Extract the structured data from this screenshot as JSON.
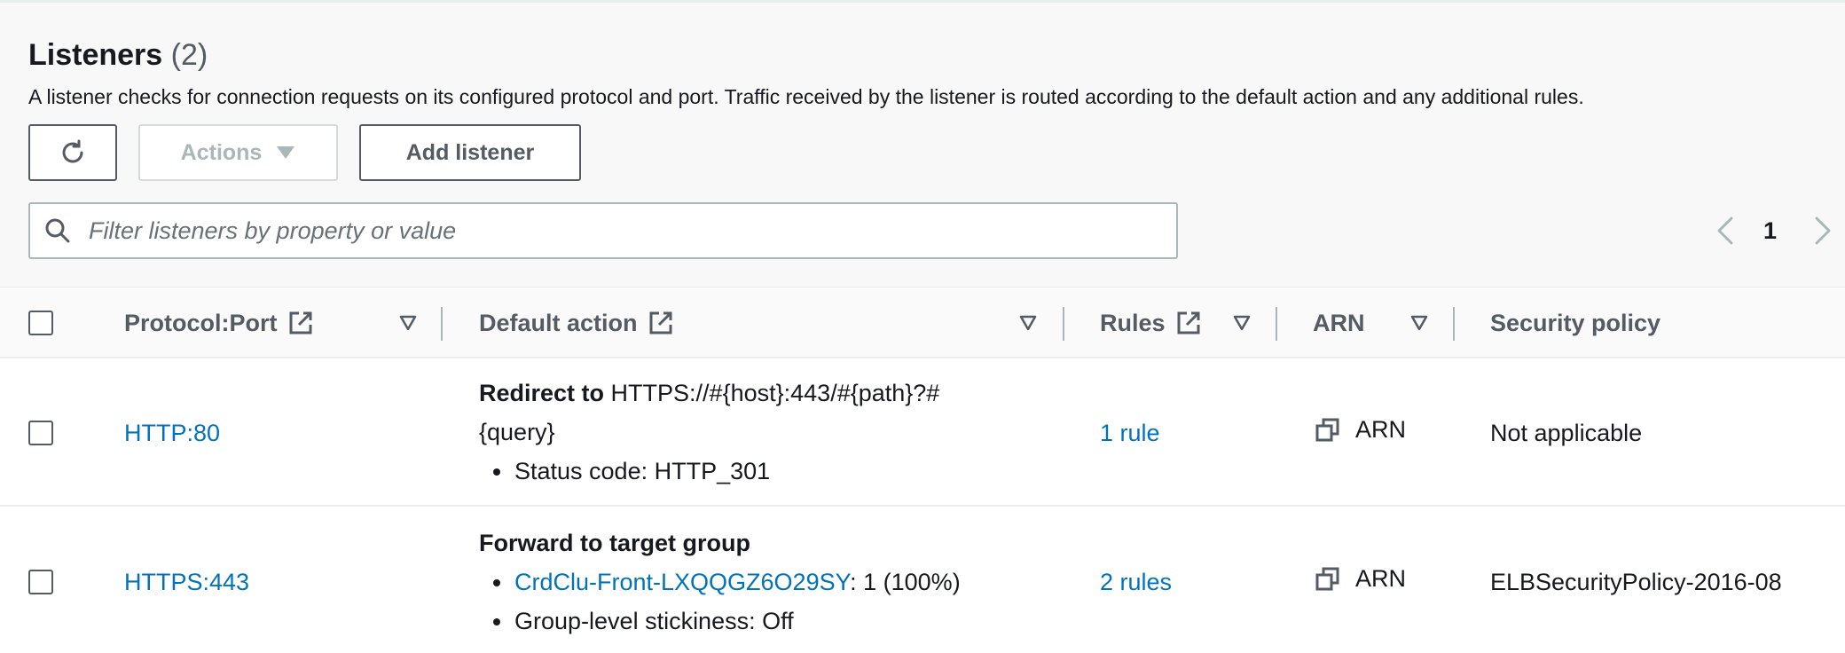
{
  "header": {
    "title": "Listeners",
    "count": "(2)",
    "description": "A listener checks for connection requests on its configured protocol and port. Traffic received by the listener is routed according to the default action and any additional rules."
  },
  "toolbar": {
    "refresh_icon": "refresh-icon",
    "actions_label": "Actions",
    "add_listener_label": "Add listener"
  },
  "filter": {
    "placeholder": "Filter listeners by property or value"
  },
  "pagination": {
    "current_page": "1"
  },
  "table": {
    "columns": {
      "protocol_port": "Protocol:Port",
      "default_action": "Default action",
      "rules": "Rules",
      "arn": "ARN",
      "security_policy": "Security policy"
    },
    "rows": [
      {
        "protocol_port": "HTTP:80",
        "action_title": "Redirect to",
        "action_target_line1": "HTTPS://#{host}:443/#{path}?#",
        "action_target_line2": "{query}",
        "bullet1": "Status code: HTTP_301",
        "rules": "1 rule",
        "arn_label": "ARN",
        "security_policy": "Not applicable"
      },
      {
        "protocol_port": "HTTPS:443",
        "action_title": "Forward to target group",
        "bullet1_link": "CrdClu-Front-LXQQGZ6O29SY",
        "bullet1_rest": ": 1 (100%)",
        "bullet2": "Group-level stickiness: Off",
        "rules": "2 rules",
        "arn_label": "ARN",
        "security_policy": "ELBSecurityPolicy-2016-08"
      }
    ]
  },
  "colors": {
    "link": "#0073bb",
    "text": "#16191f",
    "muted": "#545b64",
    "disabled": "#aab7b8"
  }
}
